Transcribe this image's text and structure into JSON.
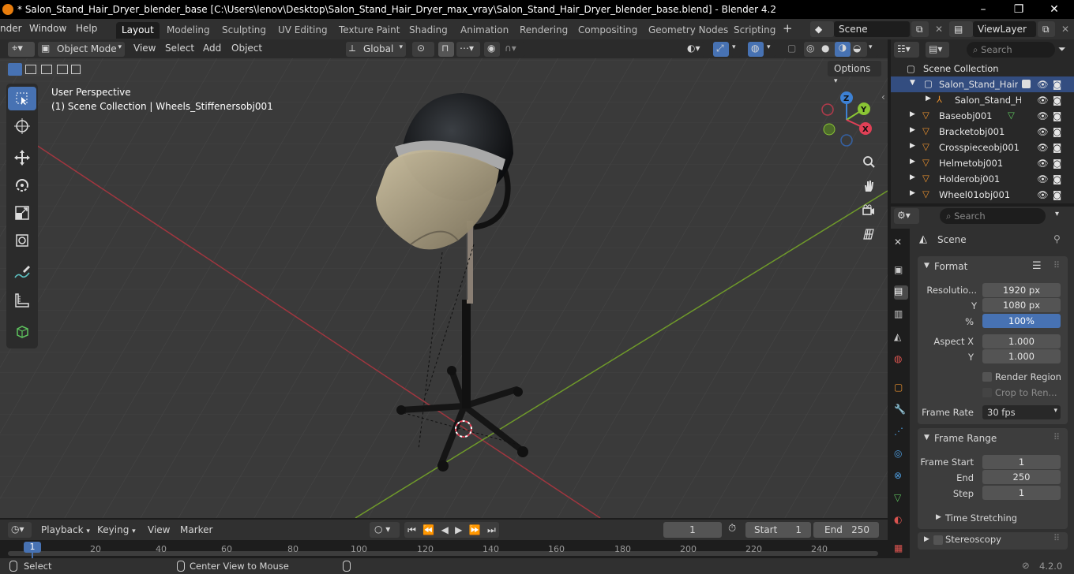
{
  "titlebar": {
    "title": "* Salon_Stand_Hair_Dryer_blender_base [C:\\Users\\lenov\\Desktop\\Salon_Stand_Hair_Dryer_max_vray\\Salon_Stand_Hair_Dryer_blender_base.blend] - Blender 4.2",
    "minimize": "–",
    "maximize": "❐",
    "close": "✕"
  },
  "menubar": {
    "menus": [
      "nder",
      "Window",
      "Help"
    ],
    "workspaces": [
      "Layout",
      "Modeling",
      "Sculpting",
      "UV Editing",
      "Texture Paint",
      "Shading",
      "Animation",
      "Rendering",
      "Compositing",
      "Geometry Nodes",
      "Scripting"
    ],
    "active_workspace": "Layout",
    "add_workspace": "+",
    "scene": "Scene",
    "view_layer": "ViewLayer"
  },
  "viewport_header": {
    "mode": "Object Mode",
    "menus": [
      "View",
      "Select",
      "Add",
      "Object"
    ],
    "orientation": "Global",
    "options": "Options"
  },
  "viewport": {
    "perspective": "User Perspective",
    "context": "(1) Scene Collection | Wheels_Stiffenersobj001",
    "gizmo_axes": [
      "Z",
      "Y",
      "X"
    ]
  },
  "outliner": {
    "search_placeholder": "Search",
    "root": "Scene Collection",
    "collection": "Salon_Stand_Hair_[",
    "items": [
      {
        "name": "Salon_Stand_H",
        "type": "armature"
      },
      {
        "name": "Baseobj001",
        "type": "mesh"
      },
      {
        "name": "Bracketobj001",
        "type": "mesh"
      },
      {
        "name": "Crosspieceobj001",
        "type": "mesh"
      },
      {
        "name": "Helmetobj001",
        "type": "mesh"
      },
      {
        "name": "Holderobj001",
        "type": "mesh"
      },
      {
        "name": "Wheel01obj001",
        "type": "mesh"
      }
    ]
  },
  "properties": {
    "search_placeholder": "Search",
    "context": "Scene",
    "format_panel": "Format",
    "resolution_label": "Resolutio...",
    "res_x": "1920 px",
    "y_label": "Y",
    "res_y": "1080 px",
    "percent_label": "%",
    "percent": "100%",
    "aspect_x_label": "Aspect X",
    "aspect_x": "1.000",
    "aspect_y_label": "Y",
    "aspect_y": "1.000",
    "render_region": "Render Region",
    "crop": "Crop to Ren...",
    "frame_rate_label": "Frame Rate",
    "frame_rate": "30 fps",
    "frame_range_panel": "Frame Range",
    "frame_start_label": "Frame Start",
    "frame_start": "1",
    "end_label": "End",
    "end": "250",
    "step_label": "Step",
    "step": "1",
    "time_stretching": "Time Stretching",
    "stereoscopy": "Stereoscopy"
  },
  "timeline": {
    "menus": [
      "Playback",
      "Keying",
      "View",
      "Marker"
    ],
    "current_frame": "1",
    "start_label": "Start",
    "start": "1",
    "end_label": "End",
    "end": "250",
    "ticks": [
      "1",
      "20",
      "40",
      "60",
      "80",
      "100",
      "120",
      "140",
      "160",
      "180",
      "200",
      "220",
      "240"
    ]
  },
  "statusbar": {
    "select": "Select",
    "center": "Center View to Mouse",
    "version": "4.2.0"
  },
  "colors": {
    "accent": "#4772b3",
    "axis_x": "#e04056",
    "axis_y": "#8ac534",
    "axis_z": "#3d81d4",
    "mesh_icon": "#e8902e"
  }
}
